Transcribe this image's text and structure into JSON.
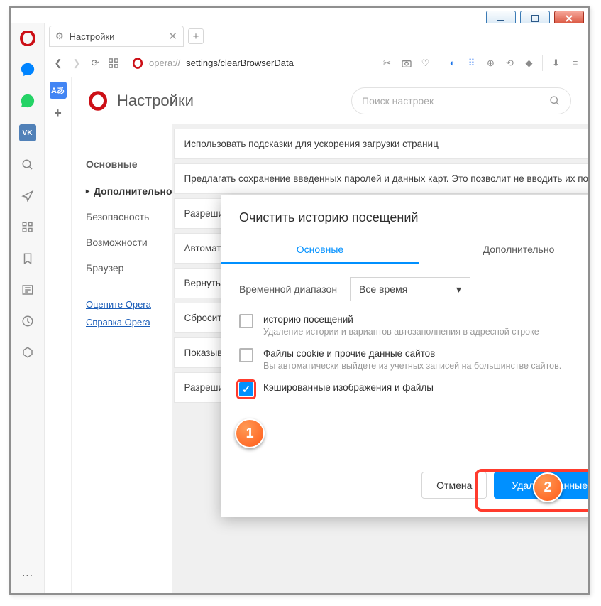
{
  "window": {
    "minimize": "–",
    "maximize": "☐",
    "close": "✕"
  },
  "tab": {
    "title": "Настройки",
    "close": "✕",
    "new": "+"
  },
  "addr": {
    "url_grey": "opera://",
    "url_dark": "settings/clearBrowserData"
  },
  "settings": {
    "title": "Настройки",
    "search_placeholder": "Поиск настроек",
    "nav": {
      "section1": "Основные",
      "section2": "Дополнительно",
      "items": [
        "Безопасность",
        "Возможности",
        "Браузер"
      ],
      "links": [
        "Оцените Opera",
        "Справка Opera"
      ]
    },
    "banners": [
      "Использовать подсказки для ускорения загрузки страниц",
      "Предлагать сохранение введенных паролей и данных карт. Это позволит не вводить их повторно.",
      "Разрешить Opera определять геолокацию. Выбранный контент показывать на основании её",
      "Автоматически очищать cookie и кеш",
      "Вернуть автоматическое обновление в браузере",
      "Сбросить всю персонализацию об истории посещений",
      "Показывать предложения новостей на основании истории посещений",
      "Разрешить партнерским поисковым системам проверять, установлены ли они по умолчанию"
    ]
  },
  "dialog": {
    "title": "Очистить историю посещений",
    "tabs": {
      "basic": "Основные",
      "advanced": "Дополнительно"
    },
    "range_label": "Временной диапазон",
    "range_value": "Все время",
    "items": [
      {
        "title": "историю посещений",
        "desc": "Удаление истории и вариантов автозаполнения в адресной строке",
        "checked": false
      },
      {
        "title": "Файлы cookie и прочие данные сайтов",
        "desc": "Вы автоматически выйдете из учетных записей на большинстве сайтов.",
        "checked": false
      },
      {
        "title": "Кэшированные изображения и файлы",
        "desc": "",
        "checked": true
      }
    ],
    "cancel": "Отмена",
    "confirm": "Удалить данные"
  },
  "annotations": {
    "one": "1",
    "two": "2"
  }
}
